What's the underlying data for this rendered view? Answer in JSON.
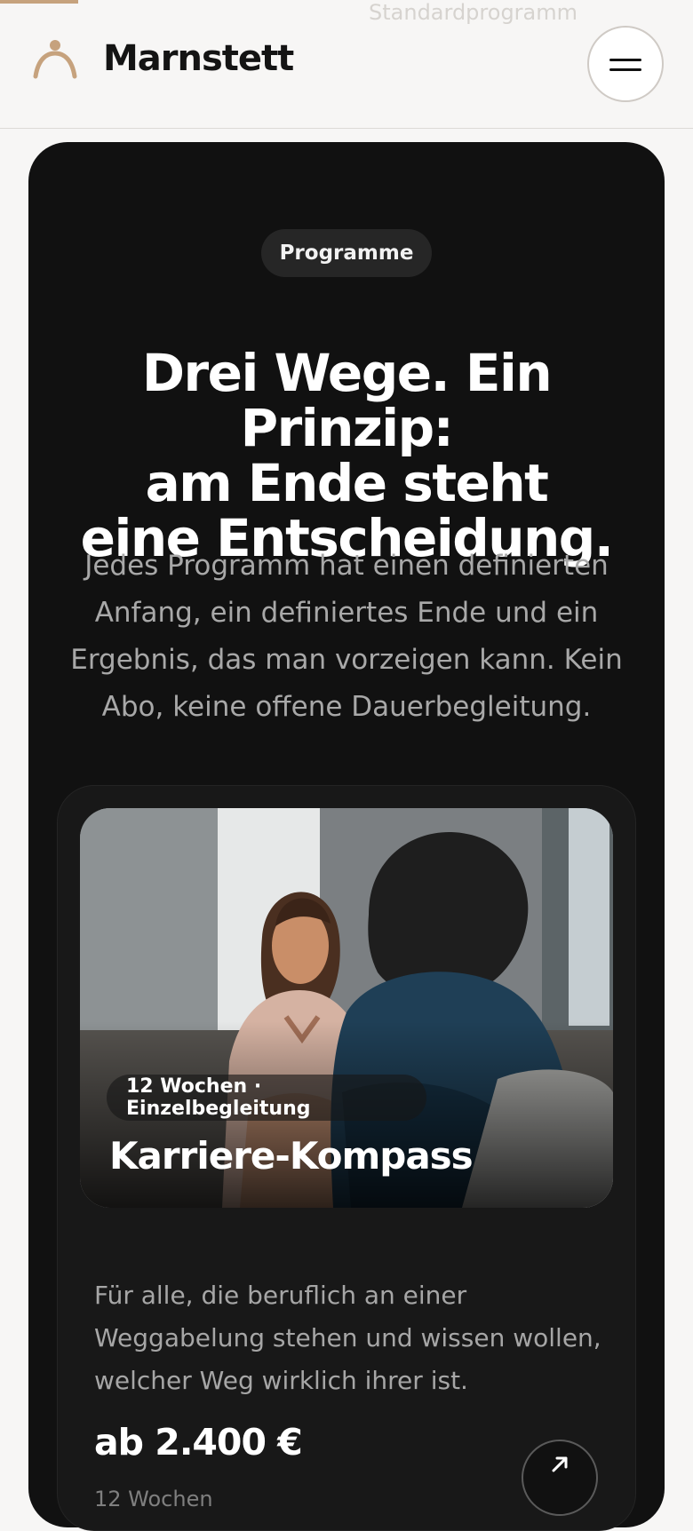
{
  "header": {
    "background_text": "Standardprogramm",
    "brand_name": "Marnstett",
    "brand_icon": "person-icon",
    "menu_icon": "menu-icon",
    "colors": {
      "accent": "#c6a27d",
      "background": "#f7f6f5",
      "dark_panel": "#111111"
    }
  },
  "section": {
    "pill": "Programme",
    "headline_line_1": "Drei Wege. Ein Prinzip:",
    "headline_line_2": "am Ende steht",
    "headline_line_3": "eine Entscheidung.",
    "intro": "Jedes Programm hat einen definierten Anfang, ein definiertes Ende und ein Ergebnis, das man vorzeigen kann. Kein Abo, keine offene Dauerbegleitung."
  },
  "program": {
    "chip": "12 Wochen · Einzelbegleitung",
    "title": "Karriere-Kompass",
    "description": "Für alle, die beruflich an einer Weggabelung stehen und wissen wollen, welcher Weg wirklich ihrer ist.",
    "price": "ab 2.400 €",
    "duration": "12 Wochen",
    "arrow_icon": "arrow-up-right-icon"
  }
}
